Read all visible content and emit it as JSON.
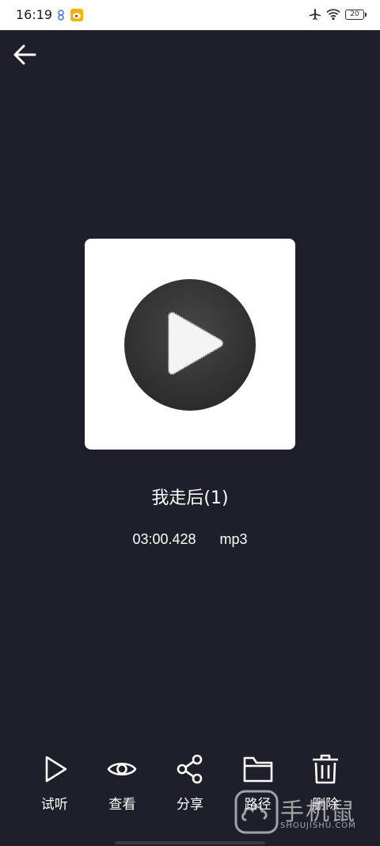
{
  "status_bar": {
    "time": "16:19",
    "battery_level": "20"
  },
  "track": {
    "title": "我走后(1)",
    "duration": "03:00.428",
    "format": "mp3"
  },
  "toolbar": {
    "items": [
      {
        "label": "试听",
        "icon": "play-outline-icon"
      },
      {
        "label": "查看",
        "icon": "eye-icon"
      },
      {
        "label": "分享",
        "icon": "share-icon"
      },
      {
        "label": "路径",
        "icon": "folder-icon"
      },
      {
        "label": "删除",
        "icon": "trash-icon"
      }
    ]
  },
  "watermark": {
    "text": "手机鼠",
    "subtext": "SHOUJISHU.COM"
  },
  "colors": {
    "background": "#1f1f2b",
    "status_bar": "#ffffff",
    "foreground": "#ffffff",
    "cover_disc": "#3a3a3a"
  }
}
